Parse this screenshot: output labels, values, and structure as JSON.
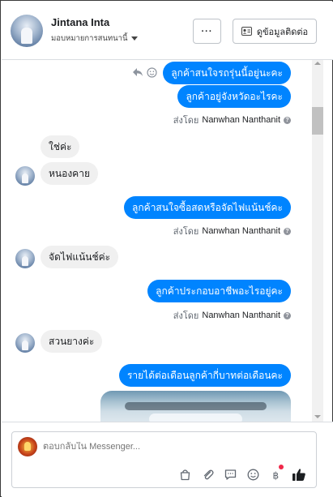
{
  "header": {
    "name": "Jintana Inta",
    "assign_label": "มอบหมายการสนทนานี้",
    "more_label": "···",
    "contact_button": "ดูข้อมูลติดต่อ"
  },
  "messages": [
    {
      "dir": "out",
      "text": "ลูกค้าสนใจรถรุ่นนี้อยู่นะคะ"
    },
    {
      "dir": "out",
      "text": "ลูกค้าอยู่จังหวัดอะไรคะ"
    },
    {
      "dir": "sent",
      "text": "ส่งโดย",
      "who": "Nanwhan Nanthanit"
    },
    {
      "dir": "in",
      "text": "ใช่ค่ะ"
    },
    {
      "dir": "in",
      "text": "หนองคาย"
    },
    {
      "dir": "out",
      "text": "ลูกค้าสนใจซื้อสดหรือจัดไฟแน้นช์คะ"
    },
    {
      "dir": "sent",
      "text": "ส่งโดย",
      "who": "Nanwhan Nanthanit"
    },
    {
      "dir": "in",
      "text": "จัดไฟแน้นช์ค่ะ"
    },
    {
      "dir": "out",
      "text": "ลูกค้าประกอบอาชีพอะไรอยู่คะ"
    },
    {
      "dir": "sent",
      "text": "ส่งโดย",
      "who": "Nanwhan Nanthanit"
    },
    {
      "dir": "in",
      "text": "สวนยางค่ะ"
    },
    {
      "dir": "out",
      "text": "รายได้ต่อเดือนลูกค้ากี่บาทต่อเดือนคะ"
    }
  ],
  "composer": {
    "placeholder": "ตอบกลับใน Messenger..."
  },
  "icons": [
    "more-icon",
    "contact-card-icon",
    "reply-icon",
    "react-icon",
    "question-icon",
    "product-icon",
    "attach-icon",
    "saved-reply-icon",
    "emoji-icon",
    "currency-icon",
    "like-icon"
  ],
  "colors": {
    "outgoing": "#0084ff",
    "incoming": "#f0f0f0",
    "notification": "#f02849"
  }
}
